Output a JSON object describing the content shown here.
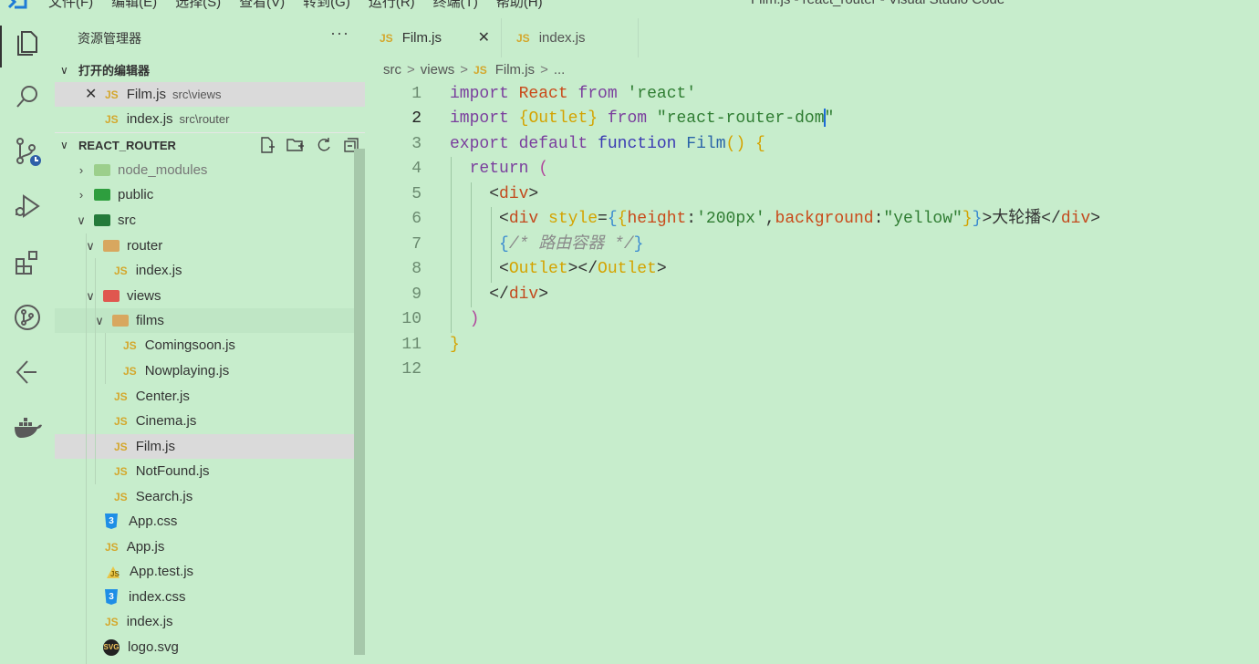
{
  "window": {
    "title": "Film.js - react_router - Visual Studio Code",
    "menus": [
      "文件(F)",
      "编辑(E)",
      "选择(S)",
      "查看(V)",
      "转到(G)",
      "运行(R)",
      "终端(T)",
      "帮助(H)"
    ]
  },
  "activity_bar": [
    "files-icon",
    "search-icon",
    "source-control-icon",
    "run-debug-icon",
    "extensions-icon",
    "git-graph-icon",
    "remote-explorer-icon",
    "docker-icon"
  ],
  "sidebar": {
    "title": "资源管理器",
    "more": "···",
    "open_editors": {
      "label": "打开的编辑器",
      "items": [
        {
          "icon": "JS",
          "name": "Film.js",
          "path": "src\\views"
        },
        {
          "icon": "JS",
          "name": "index.js",
          "path": "src\\router"
        }
      ]
    },
    "project": {
      "label": "REACT_ROUTER",
      "tree": [
        {
          "name": "node_modules"
        },
        {
          "name": "public"
        },
        {
          "name": "src"
        },
        {
          "name": "router"
        },
        {
          "name": "index.js",
          "icon": "JS"
        },
        {
          "name": "views"
        },
        {
          "name": "films"
        },
        {
          "name": "Comingsoon.js",
          "icon": "JS"
        },
        {
          "name": "Nowplaying.js",
          "icon": "JS"
        },
        {
          "name": "Center.js",
          "icon": "JS"
        },
        {
          "name": "Cinema.js",
          "icon": "JS"
        },
        {
          "name": "Film.js",
          "icon": "JS"
        },
        {
          "name": "NotFound.js",
          "icon": "JS"
        },
        {
          "name": "Search.js",
          "icon": "JS"
        },
        {
          "name": "App.css",
          "icon": "3"
        },
        {
          "name": "App.js",
          "icon": "JS"
        },
        {
          "name": "App.test.js",
          "icon": "JS"
        },
        {
          "name": "index.css",
          "icon": "3"
        },
        {
          "name": "index.js",
          "icon": "JS"
        },
        {
          "name": "logo.svg",
          "icon": "SVG"
        }
      ]
    }
  },
  "tabs": [
    {
      "icon": "JS",
      "label": "Film.js",
      "close": "✕",
      "active": true
    },
    {
      "icon": "JS",
      "label": "index.js",
      "active": false
    }
  ],
  "breadcrumb": {
    "parts": [
      "src",
      "views",
      "Film.js",
      "..."
    ],
    "sep": ">",
    "icon": "JS"
  },
  "editor": {
    "line_numbers": [
      "1",
      "2",
      "3",
      "4",
      "5",
      "6",
      "7",
      "8",
      "9",
      "10",
      "11",
      "12"
    ],
    "current_line": "2",
    "lines": [
      "import React from 'react'",
      "import {Outlet} from \"react-router-dom\"",
      "export default function Film() {",
      "  return (",
      "    <div>",
      "     <div style={{height:'200px',background:\"yellow\"}}>大轮播</div>",
      "     {/* 路由容器 */}",
      "     <Outlet></Outlet>",
      "    </div>",
      "  )",
      "}",
      ""
    ]
  }
}
